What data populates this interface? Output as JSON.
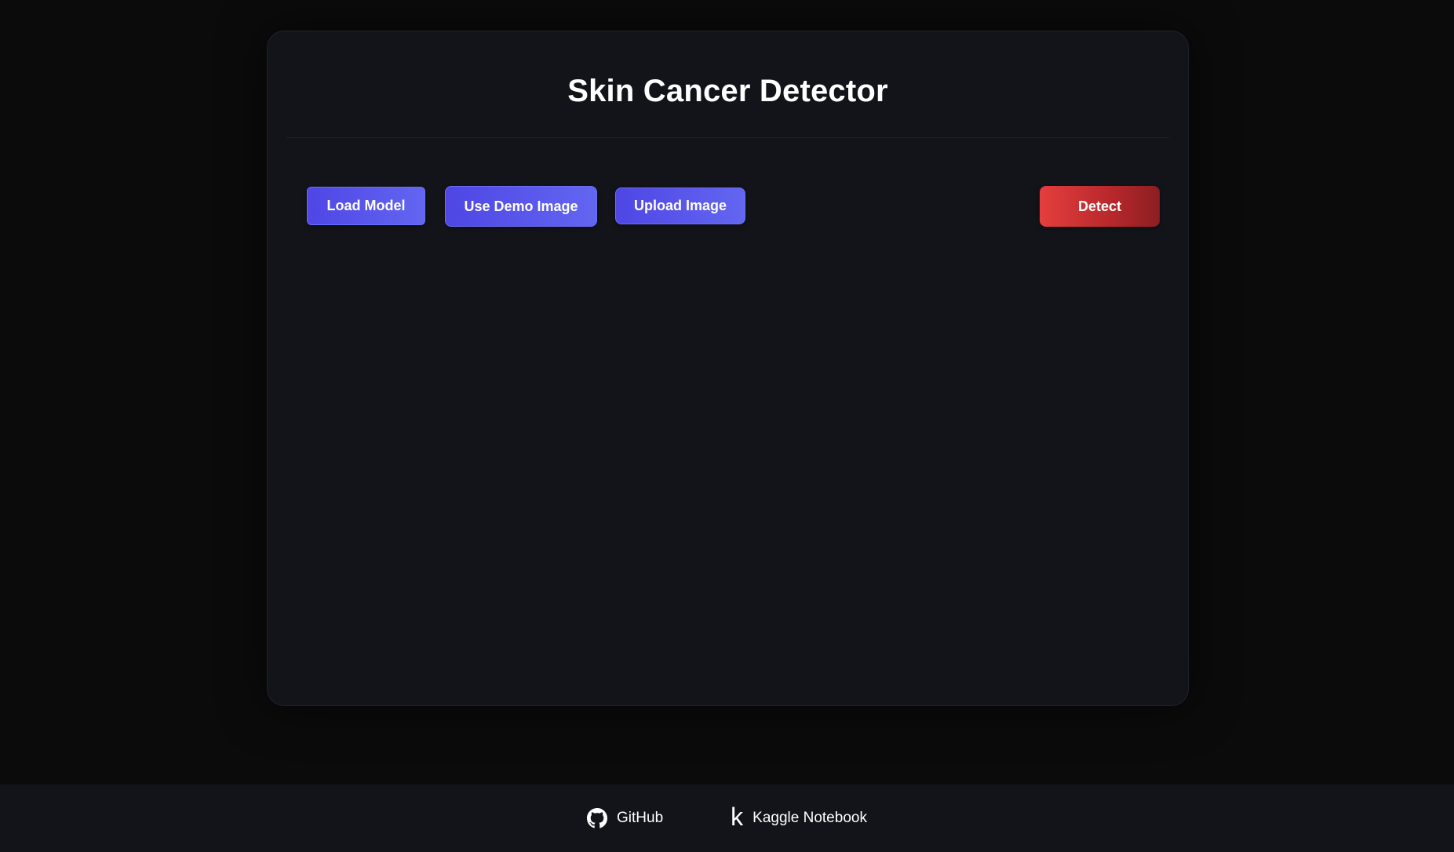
{
  "app": {
    "title": "Skin Cancer Detector"
  },
  "toolbar": {
    "load_model_label": "Load Model",
    "demo_image_label": "Use Demo Image",
    "upload_image_label": "Upload Image",
    "detect_label": "Detect"
  },
  "footer": {
    "links": [
      {
        "label": "GitHub",
        "icon": "github-icon"
      },
      {
        "label": "Kaggle Notebook",
        "icon": "kaggle-icon"
      }
    ]
  },
  "colors": {
    "background": "#0b0b0c",
    "card": "#13141a",
    "primary": "#4f46e5",
    "danger": "#e53e3e"
  }
}
